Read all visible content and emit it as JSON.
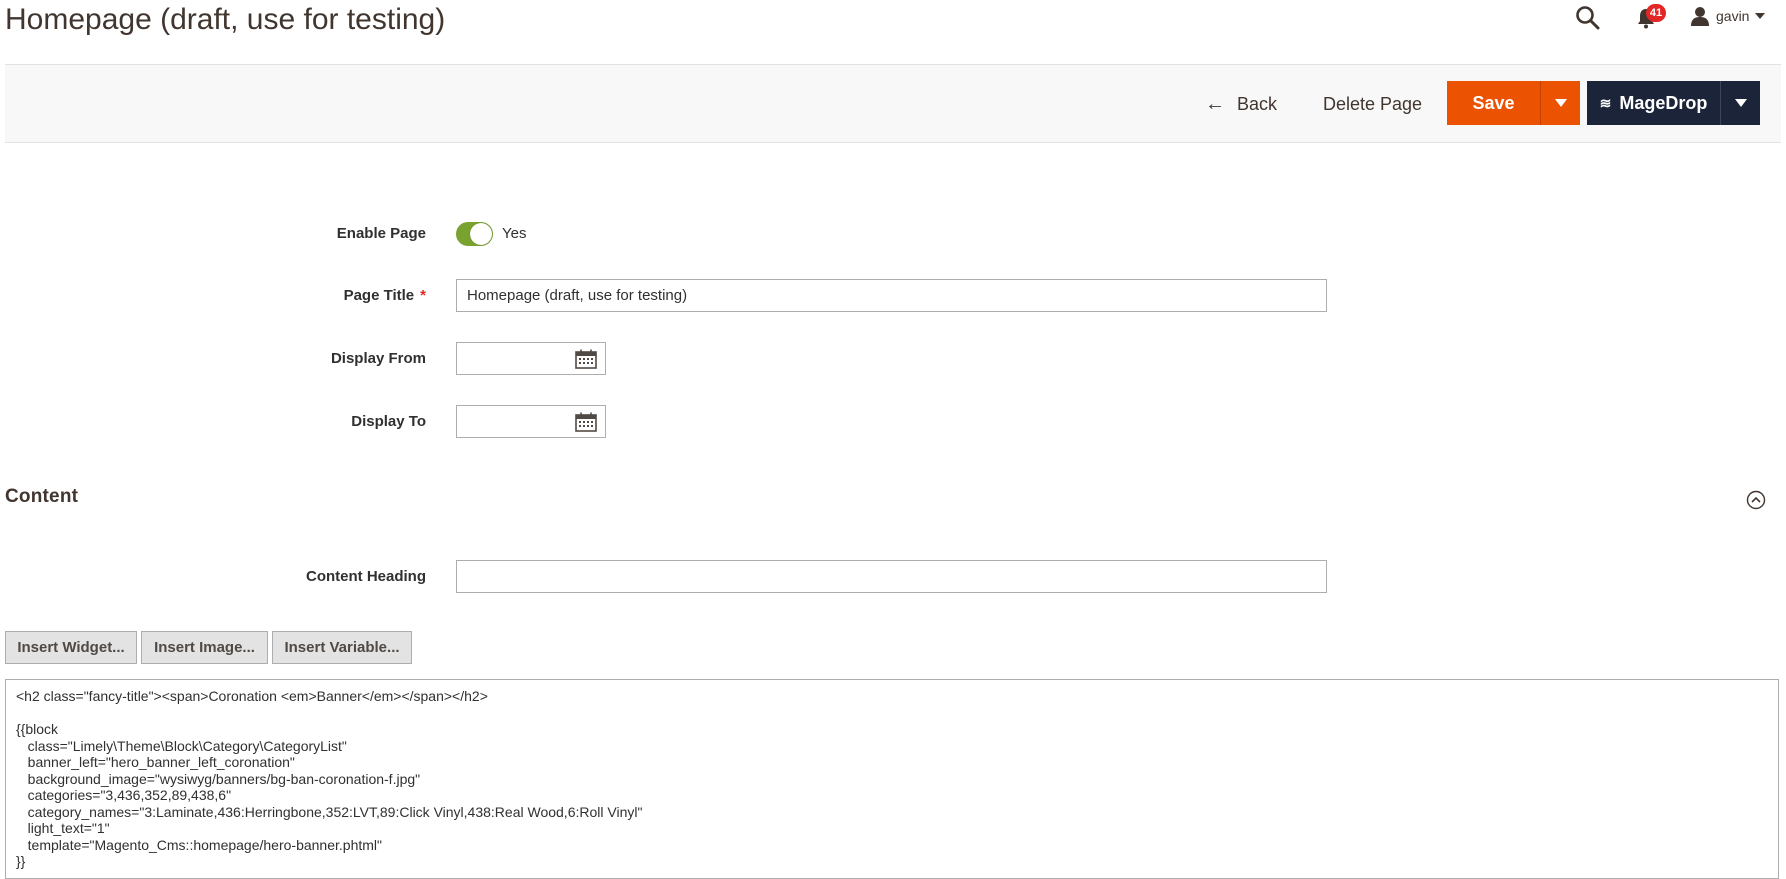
{
  "page": {
    "title": "Homepage (draft, use for testing)"
  },
  "header": {
    "notifications_count": "41",
    "user_name": "gavin"
  },
  "actions": {
    "back_label": "Back",
    "delete_label": "Delete Page",
    "save_label": "Save",
    "magedrop_label": "MageDrop"
  },
  "form": {
    "enable_page": {
      "label": "Enable Page",
      "value_text": "Yes",
      "enabled": true
    },
    "page_title": {
      "label": "Page Title",
      "value": "Homepage (draft, use for testing)"
    },
    "display_from": {
      "label": "Display From",
      "value": ""
    },
    "display_to": {
      "label": "Display To",
      "value": ""
    }
  },
  "content": {
    "section_title": "Content",
    "heading": {
      "label": "Content Heading",
      "value": ""
    },
    "buttons": {
      "insert_widget": "Insert Widget...",
      "insert_image": "Insert Image...",
      "insert_variable": "Insert Variable..."
    },
    "editor_text": "<h2 class=\"fancy-title\"><span>Coronation <em>Banner</em></span></h2>\n\n{{block\n   class=\"Limely\\Theme\\Block\\Category\\CategoryList\"\n   banner_left=\"hero_banner_left_coronation\"\n   background_image=\"wysiwyg/banners/bg-ban-coronation-f.jpg\"\n   categories=\"3,436,352,89,438,6\"\n   category_names=\"3:Laminate,436:Herringbone,352:LVT,89:Click Vinyl,438:Real Wood,6:Roll Vinyl\"\n   light_text=\"1\"\n   template=\"Magento_Cms::homepage/hero-banner.phtml\"\n}}"
  },
  "colors": {
    "accent_orange": "#eb5202",
    "magedrop_navy": "#1c2439",
    "toggle_green": "#79a22e",
    "badge_red": "#e22626"
  }
}
